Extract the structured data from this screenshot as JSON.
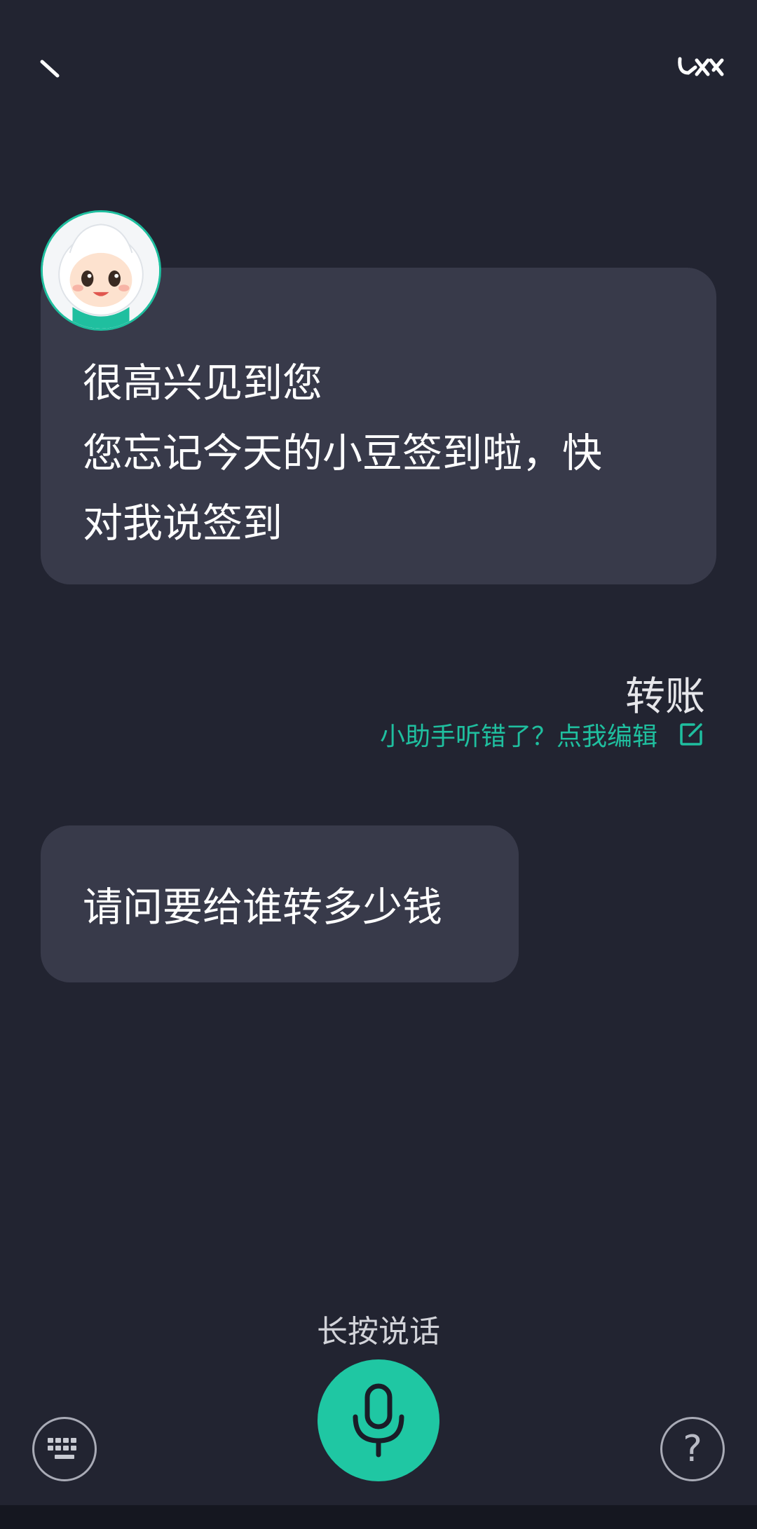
{
  "header": {
    "back_icon": "back-arrow-icon",
    "brand_icon": "brand-logo-icon"
  },
  "assistant": {
    "avatar_icon": "assistant-mascot-avatar",
    "messages": [
      {
        "lines": [
          "很高兴见到您",
          "您忘记今天的小豆签到啦，快",
          "对我说签到"
        ]
      },
      {
        "lines": [
          "请问要给谁转多少钱"
        ]
      }
    ]
  },
  "user": {
    "message": "转账",
    "edit_hint": "小助手听错了？点我编辑",
    "edit_icon": "edit-icon"
  },
  "controls": {
    "hold_to_talk_label": "长按说话",
    "mic_icon": "microphone-icon",
    "keyboard_icon": "keyboard-icon",
    "help_symbol": "?"
  },
  "colors": {
    "background": "#222431",
    "bubble": "#383a4a",
    "accent": "#1fc7a3",
    "hint_text": "#1fbf9f"
  }
}
